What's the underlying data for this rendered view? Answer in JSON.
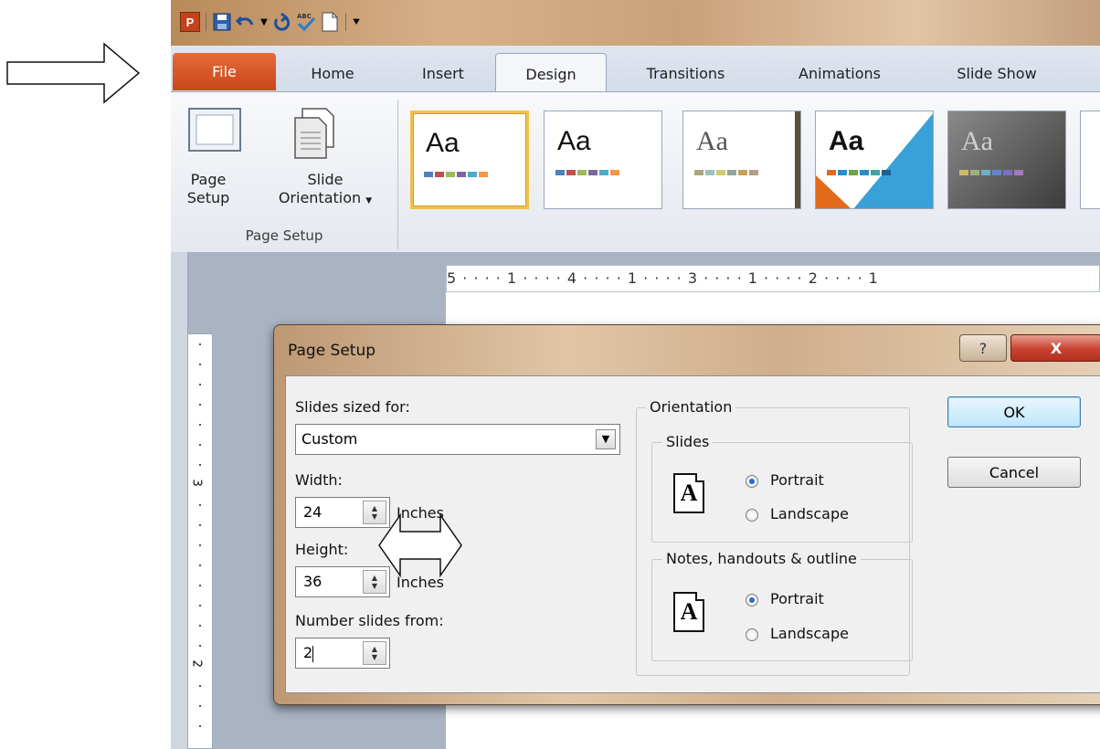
{
  "quick_access": {
    "app_icon_letter": "P"
  },
  "tabs": [
    {
      "label": "File"
    },
    {
      "label": "Home"
    },
    {
      "label": "Insert"
    },
    {
      "label": "Design"
    },
    {
      "label": "Transitions"
    },
    {
      "label": "Animations"
    },
    {
      "label": "Slide Show"
    }
  ],
  "ribbon": {
    "page_setup_line1": "Page",
    "page_setup_line2": "Setup",
    "slide_orientation_line1": "Slide",
    "slide_orientation_line2": "Orientation",
    "group_label": "Page Setup",
    "theme_sample": "Aa"
  },
  "ruler": {
    "text": "5 · · · · 1 · · · · 4 · · · · 1 · · · · 3 · · · · 1 · · · · 2 · · · · 1",
    "vertical_digit_a": "3",
    "vertical_digit_b": "2"
  },
  "dialog": {
    "title": "Page Setup",
    "help_glyph": "?",
    "close_glyph": "X",
    "slides_sized_for_label": "Slides sized for:",
    "slides_sized_for_value": "Custom",
    "width_label": "Width:",
    "width_value": "24",
    "width_unit": "Inches",
    "height_label": "Height:",
    "height_value": "36",
    "height_unit": "Inches",
    "number_slides_label": "Number slides from:",
    "number_slides_value": "2",
    "orientation_label": "Orientation",
    "slides_label": "Slides",
    "notes_label": "Notes, handouts & outline",
    "portrait_label": "Portrait",
    "landscape_label": "Landscape",
    "orient_icon_letter": "A",
    "ok_label": "OK",
    "cancel_label": "Cancel"
  },
  "colors": {
    "file_tab": "#d3521f",
    "selected_theme_border": "#f2c04a",
    "close_button": "#c8402f",
    "radio_selected": "#2a6bc6"
  }
}
